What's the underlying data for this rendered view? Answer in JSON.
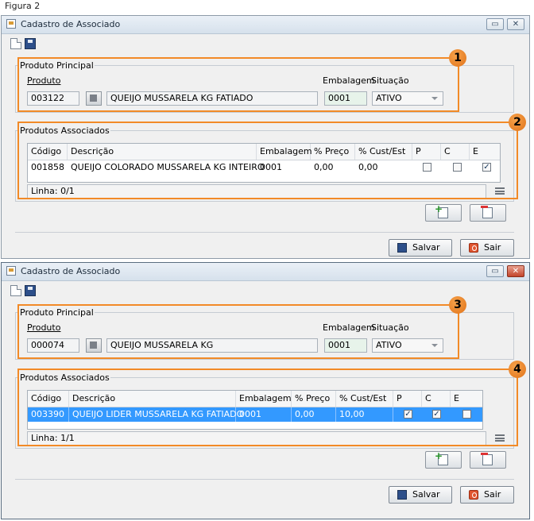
{
  "caption": "Figura 2",
  "windows": [
    {
      "title": "Cadastro de Associado",
      "principal": {
        "legend": "Produto Principal",
        "produto_label": "Produto",
        "embalagem_label": "Embalagem",
        "situacao_label": "Situação",
        "codigo": "003122",
        "descricao": "QUEIJO MUSSARELA KG FATIADO",
        "embalagem": "0001",
        "situacao": "ATIVO"
      },
      "associados": {
        "legend": "Produtos Associados",
        "columns": [
          "Código",
          "Descrição",
          "Embalagem",
          "% Preço",
          "% Cust/Est",
          "P",
          "C",
          "E"
        ],
        "rows": [
          {
            "codigo": "001858",
            "descricao": "QUEIJO COLORADO MUSSARELA KG INTEIRO",
            "embalagem": "0001",
            "preco": "0,00",
            "custo": "0,00",
            "p": false,
            "c": false,
            "e": true
          }
        ],
        "status": "Linha: 0/1"
      },
      "callouts": [
        "1",
        "2"
      ],
      "save_label": "Salvar",
      "exit_label": "Sair"
    },
    {
      "title": "Cadastro de Associado",
      "principal": {
        "legend": "Produto Principal",
        "produto_label": "Produto",
        "embalagem_label": "Embalagem",
        "situacao_label": "Situação",
        "codigo": "000074",
        "descricao": "QUEIJO MUSSARELA KG",
        "embalagem": "0001",
        "situacao": "ATIVO"
      },
      "associados": {
        "legend": "Produtos Associados",
        "columns": [
          "Código",
          "Descrição",
          "Embalagem",
          "% Preço",
          "% Cust/Est",
          "P",
          "C",
          "E"
        ],
        "rows": [
          {
            "codigo": "003390",
            "descricao": "QUEIJO LIDER MUSSARELA KG FATIADO",
            "embalagem": "0001",
            "preco": "0,00",
            "custo": "10,00",
            "p": true,
            "c": true,
            "e": false
          }
        ],
        "status": "Linha: 1/1"
      },
      "callouts": [
        "3",
        "4"
      ],
      "save_label": "Salvar",
      "exit_label": "Sair"
    }
  ]
}
